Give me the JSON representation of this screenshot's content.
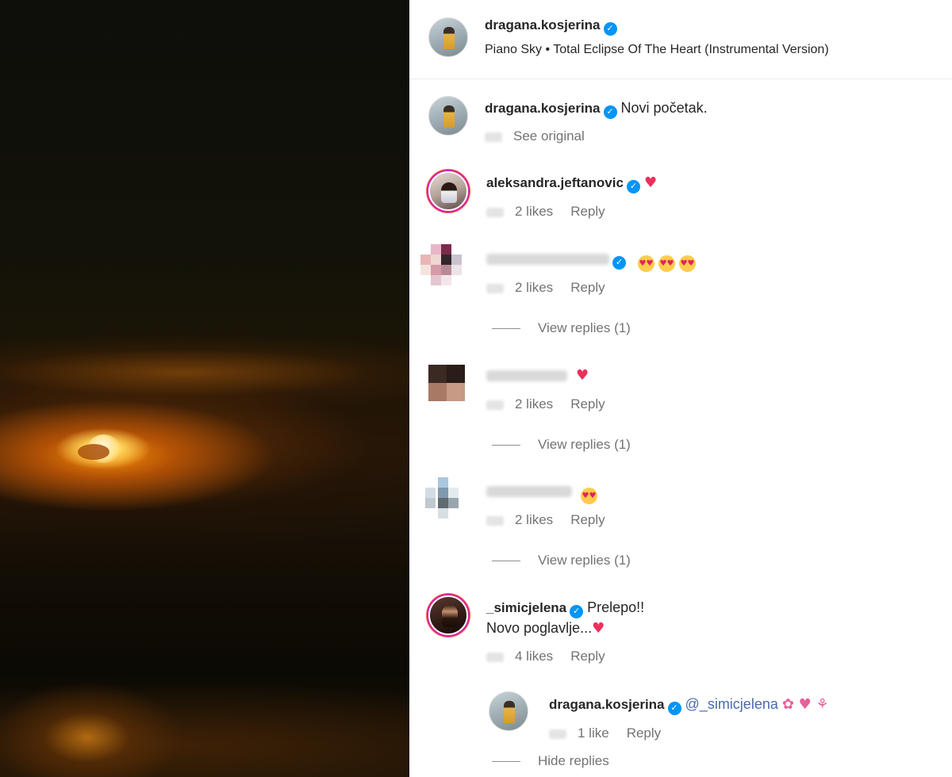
{
  "post": {
    "username": "dragana.kosjerina",
    "audio": "Piano Sky • Total Eclipse Of The Heart (Instrumental Version)"
  },
  "caption": {
    "username": "dragana.kosjerina",
    "text": "Novi početak.",
    "see_original": "See original"
  },
  "comments": [
    {
      "username": "aleksandra.jeftanovic",
      "text": "♥",
      "likes": "2 likes",
      "reply": "Reply"
    },
    {
      "username": "",
      "text": "",
      "likes": "2 likes",
      "reply": "Reply",
      "view_replies": "View replies (1)"
    },
    {
      "username": "",
      "text": "♥",
      "likes": "2 likes",
      "reply": "Reply",
      "view_replies": "View replies (1)"
    },
    {
      "username": "",
      "text": "",
      "likes": "2 likes",
      "reply": "Reply",
      "view_replies": "View replies (1)"
    },
    {
      "username": "_simicjelena",
      "text": "Prelepo!!",
      "text2": "Novo poglavlje...",
      "text2_emoji": "♥",
      "likes": "4 likes",
      "reply": "Reply"
    }
  ],
  "nested_reply": {
    "username": "dragana.kosjerina",
    "mention": "@_simicjelena",
    "emojis": "✿ ♥ ⚘",
    "likes": "1 like",
    "reply": "Reply",
    "hide_replies": "Hide replies"
  },
  "icons": [
    "verified-badge-icon",
    "heart-emoji-icon",
    "heart-eyes-emoji-icon",
    "flower-emoji-icon",
    "butterfly-emoji-icon"
  ],
  "colors": {
    "verified": "#0095f6",
    "heart": "#ed2f5b",
    "secondary_text": "#737373",
    "mention": "#4a6aa8"
  }
}
